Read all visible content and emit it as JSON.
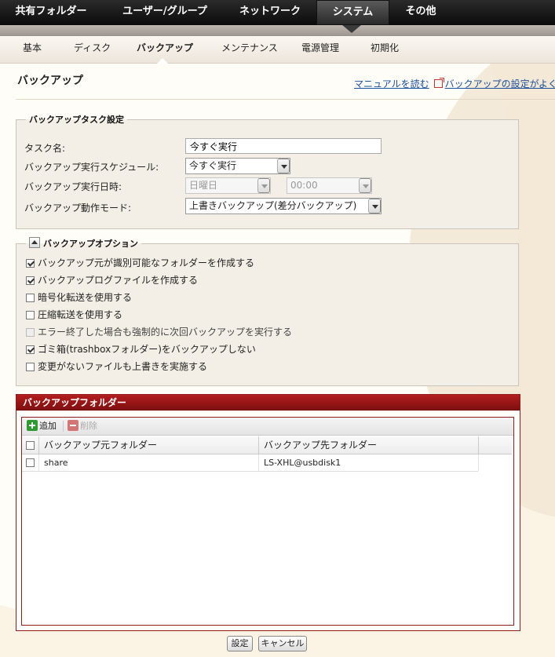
{
  "topnav": {
    "items": [
      "共有フォルダー",
      "ユーザー/グループ",
      "ネットワーク",
      "システム",
      "その他"
    ],
    "active_index": 3
  },
  "subnav": {
    "items": [
      "基本",
      "ディスク",
      "バックアップ",
      "メンテナンス",
      "電源管理",
      "初期化"
    ],
    "active_index": 2
  },
  "page": {
    "title": "バックアップ",
    "help_link_manual": "マニュアルを読む",
    "help_link_faq": "バックアップの設定がよくわか"
  },
  "task_settings": {
    "legend": "バックアップタスク設定",
    "task_name_label": "タスク名:",
    "task_name_value": "今すぐ実行",
    "schedule_label": "バックアップ実行スケジュール:",
    "schedule_value": "今すぐ実行",
    "datetime_label": "バックアップ実行日時:",
    "day_value": "日曜日",
    "time_value": "00:00",
    "mode_label": "バックアップ動作モード:",
    "mode_value": "上書きバックアップ(差分バックアップ)"
  },
  "options": {
    "legend": "バックアップオプション",
    "items": [
      {
        "label": "バックアップ元が識別可能なフォルダーを作成する",
        "checked": true
      },
      {
        "label": "バックアップログファイルを作成する",
        "checked": true
      },
      {
        "label": "暗号化転送を使用する",
        "checked": false
      },
      {
        "label": "圧縮転送を使用する",
        "checked": false
      },
      {
        "label": "エラー終了した場合も強制的に次回バックアップを実行する",
        "checked": false,
        "disabled": true
      },
      {
        "label": "ゴミ箱(trashboxフォルダー)をバックアップしない",
        "checked": true
      },
      {
        "label": "変更がないファイルも上書きを実施する",
        "checked": false
      }
    ]
  },
  "folders": {
    "title": "バックアップフォルダー",
    "add_label": "追加",
    "delete_label": "削除",
    "col_source": "バックアップ元フォルダー",
    "col_dest": "バックアップ先フォルダー",
    "rows": [
      {
        "source": "share",
        "dest": "LS-XHL@usbdisk1"
      }
    ]
  },
  "footer": {
    "ok_label": "設定",
    "cancel_label": "キャンセル"
  }
}
